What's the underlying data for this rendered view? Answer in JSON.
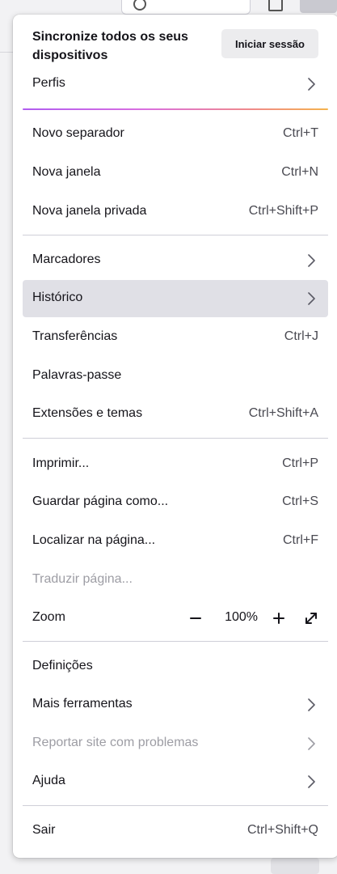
{
  "sync": {
    "heading": "Sincronize todos os seus dispositivos",
    "signin_label": "Iniciar sessão"
  },
  "menu": {
    "profiles": {
      "label": "Perfis"
    },
    "new_tab": {
      "label": "Novo separador",
      "shortcut": "Ctrl+T"
    },
    "new_window": {
      "label": "Nova janela",
      "shortcut": "Ctrl+N"
    },
    "new_private_window": {
      "label": "Nova janela privada",
      "shortcut": "Ctrl+Shift+P"
    },
    "bookmarks": {
      "label": "Marcadores"
    },
    "history": {
      "label": "Histórico"
    },
    "downloads": {
      "label": "Transferências",
      "shortcut": "Ctrl+J"
    },
    "passwords": {
      "label": "Palavras-passe"
    },
    "addons": {
      "label": "Extensões e temas",
      "shortcut": "Ctrl+Shift+A"
    },
    "print": {
      "label": "Imprimir...",
      "shortcut": "Ctrl+P"
    },
    "save_page": {
      "label": "Guardar página como...",
      "shortcut": "Ctrl+S"
    },
    "find": {
      "label": "Localizar na página...",
      "shortcut": "Ctrl+F"
    },
    "translate": {
      "label": "Traduzir página..."
    },
    "zoom": {
      "label": "Zoom",
      "value": "100%",
      "out_symbol": "−",
      "in_symbol": "+"
    },
    "settings": {
      "label": "Definições"
    },
    "more_tools": {
      "label": "Mais ferramentas"
    },
    "report_site": {
      "label": "Reportar site com problemas"
    },
    "help": {
      "label": "Ajuda"
    },
    "exit": {
      "label": "Sair",
      "shortcut": "Ctrl+Shift+Q"
    }
  },
  "icons": {
    "chevron": "chevron-right-icon",
    "fullscreen": "fullscreen-expand-icon"
  },
  "colors": {
    "hover_bg": "#e0e0e6",
    "text": "#15141a",
    "disabled_text": "#9d9da4",
    "accent_gradient": [
      "#b05cf0",
      "#f5b34c"
    ]
  }
}
